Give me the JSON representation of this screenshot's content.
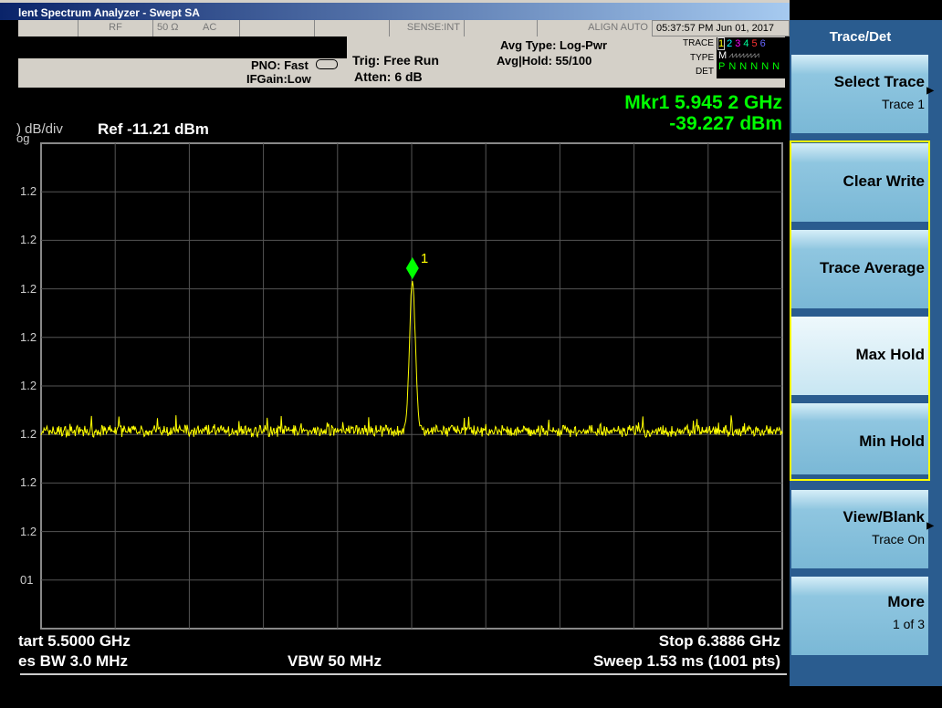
{
  "window": {
    "title": "lent Spectrum Analyzer - Swept SA"
  },
  "status": {
    "rf": "RF",
    "impedance": "50 Ω",
    "coupling": "AC",
    "sense": "SENSE:INT",
    "align": "ALIGN AUTO",
    "datetime": "05:37:57 PM Jun 01, 2017"
  },
  "settings": {
    "pno": "PNO: Fast",
    "ifgain": "IFGain:Low",
    "trig": "Trig: Free Run",
    "atten": "Atten: 6 dB",
    "avg_type": "Avg Type: Log-Pwr",
    "avg_hold": "Avg|Hold: 55/100"
  },
  "trace_table": {
    "trace_label": "TRACE",
    "type_label": "TYPE",
    "det_label": "DET",
    "traces": [
      "1",
      "2",
      "3",
      "4",
      "5",
      "6"
    ],
    "trace_colors": [
      "#ffff00",
      "#00ffff",
      "#ff00ff",
      "#00ff99",
      "#ff3333",
      "#6666ff"
    ],
    "type": "M",
    "det": [
      "P",
      "N",
      "N",
      "N",
      "N",
      "N"
    ]
  },
  "marker": {
    "line1": "Mkr1 5.945 2 GHz",
    "line2": "-39.227 dBm",
    "label": "1"
  },
  "display": {
    "scale": ") dB/div",
    "ref": "Ref -11.21 dBm",
    "log": "og",
    "y_labels": [
      "1.2",
      "1.2",
      "1.2",
      "1.2",
      "1.2",
      "1.2",
      "1.2",
      "1.2",
      "01"
    ]
  },
  "footer": {
    "start": "tart 5.5000 GHz",
    "stop": "Stop 6.3886 GHz",
    "rbw": "es BW 3.0 MHz",
    "vbw": "VBW 50 MHz",
    "sweep": "Sweep  1.53 ms (1001 pts)"
  },
  "softkeys": {
    "title": "Trace/Det",
    "select_trace": "Select Trace",
    "select_trace_sub": "Trace 1",
    "clear_write": "Clear Write",
    "trace_average": "Trace Average",
    "max_hold": "Max Hold",
    "min_hold": "Min Hold",
    "view_blank": "View/Blank",
    "view_blank_sub": "Trace On",
    "more": "More",
    "more_sub": "1 of 3"
  },
  "chart_data": {
    "type": "line",
    "x_start_ghz": 5.5,
    "x_stop_ghz": 6.3886,
    "ref_dbm": -11.21,
    "db_per_div": 10,
    "divisions": 10,
    "points": 1001,
    "noise_floor_dbm": -71,
    "peak": {
      "freq_ghz": 5.9452,
      "level_dbm": -39.227
    },
    "trace_color": "#ffff00",
    "grid": true
  }
}
